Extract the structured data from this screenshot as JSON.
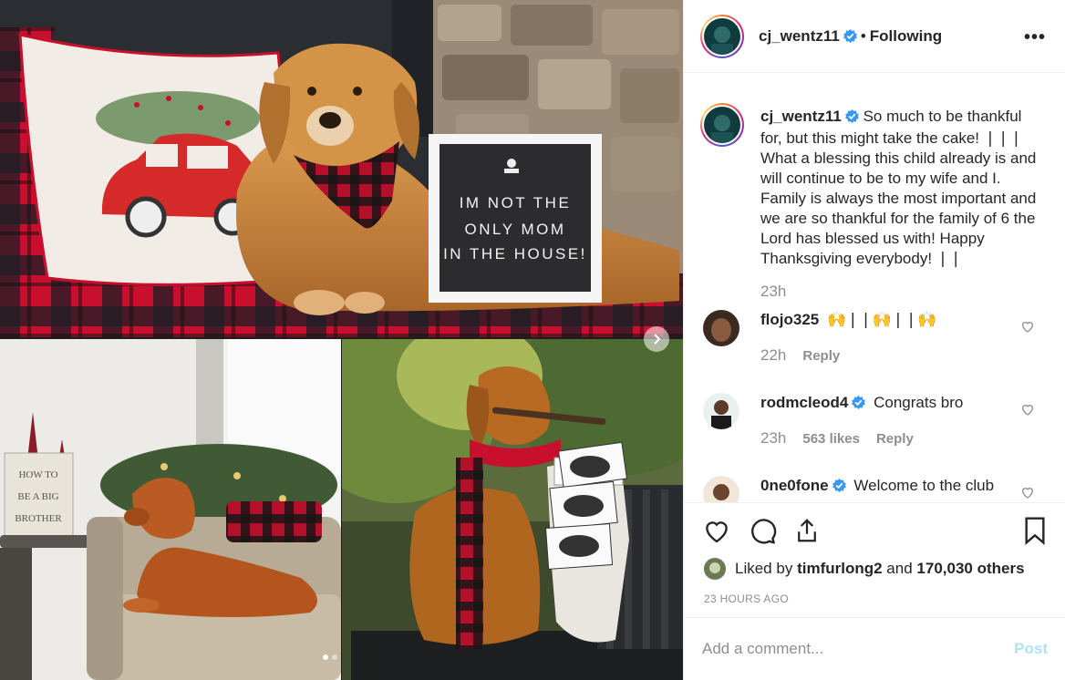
{
  "post": {
    "author": "cj_wentz11",
    "follow_state": "Following",
    "separator": "•",
    "more_icon": "more-dots-icon"
  },
  "media": {
    "sign_text": "IM NOT THE\nONLY MOM\nIN THE HOUSE!",
    "box_text": "HOW TO\nBE A BIG\nBROTHER",
    "carousel_dots": 2
  },
  "caption": {
    "username": "cj_wentz11",
    "text": "So much to be thankful for, but this might take the cake! ❘❘❘ What a blessing this child already is and will continue to be to my wife and I. Family is always the most important and we are so thankful for the family of 6 the Lord has blessed us with! Happy Thanksgiving everybody! ❘❘",
    "time": "23h"
  },
  "comments": [
    {
      "username": "flojo325",
      "text": "🙌❘❘🙌❘❘🙌",
      "time": "22h",
      "likes": "",
      "reply": "Reply",
      "verified": false
    },
    {
      "username": "rodmcleod4",
      "text": "Congrats bro",
      "time": "23h",
      "likes": "563 likes",
      "reply": "Reply",
      "verified": true
    },
    {
      "username": "0ne0fone",
      "text": "Welcome to the club",
      "time": "",
      "likes": "",
      "reply": "",
      "verified": true
    }
  ],
  "likes": {
    "prefix": "Liked by",
    "user": "timfurlong2",
    "and": "and",
    "count": "170,030 others"
  },
  "timestamp": "23 HOURS AGO",
  "composer": {
    "placeholder": "Add a comment...",
    "post_label": "Post"
  },
  "colors": {
    "verified": "#3897f0",
    "post_disabled": "#b2dffc",
    "muted": "#8e8e8e",
    "text": "#262626",
    "plaid_red": "#c8102e"
  }
}
